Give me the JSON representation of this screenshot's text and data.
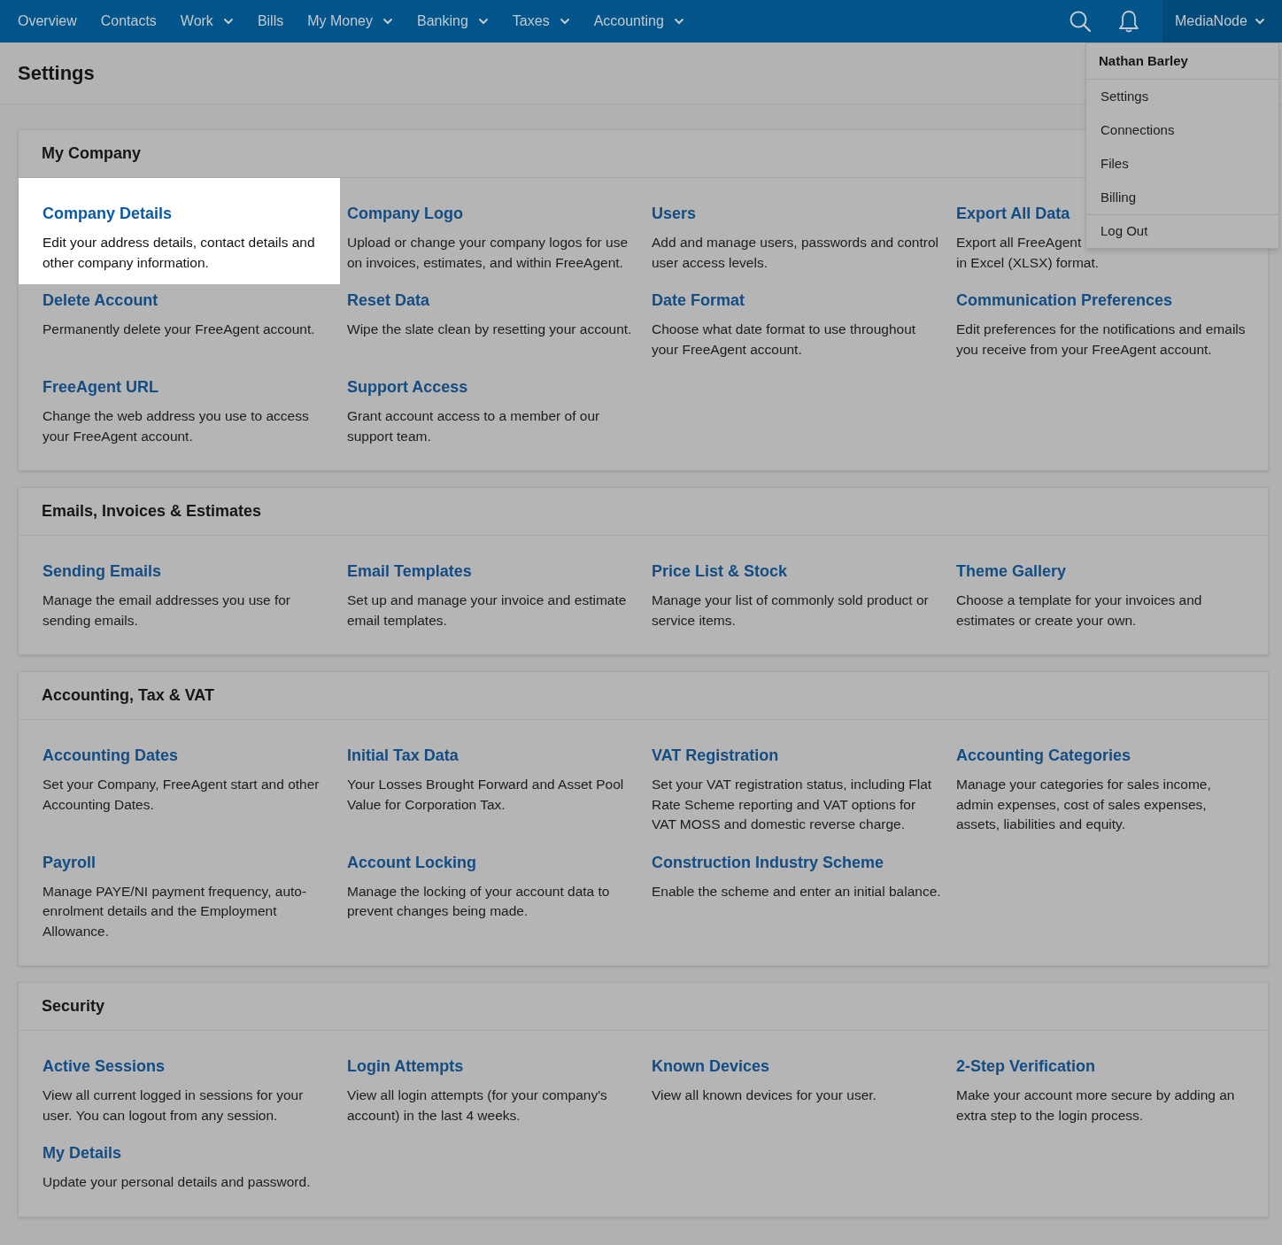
{
  "nav": {
    "items": [
      {
        "label": "Overview",
        "dropdown": false
      },
      {
        "label": "Contacts",
        "dropdown": false
      },
      {
        "label": "Work",
        "dropdown": true
      },
      {
        "label": "Bills",
        "dropdown": false
      },
      {
        "label": "My Money",
        "dropdown": true
      },
      {
        "label": "Banking",
        "dropdown": true
      },
      {
        "label": "Taxes",
        "dropdown": true
      },
      {
        "label": "Accounting",
        "dropdown": true
      }
    ],
    "account": "MediaNode"
  },
  "page_title": "Settings",
  "account_menu": {
    "header": "Nathan Barley",
    "items": [
      {
        "label": "Settings",
        "divider_before": false
      },
      {
        "label": "Connections",
        "divider_before": false
      },
      {
        "label": "Files",
        "divider_before": false
      },
      {
        "label": "Billing",
        "divider_before": false
      },
      {
        "label": "Log Out",
        "divider_before": true
      }
    ]
  },
  "sections": [
    {
      "title": "My Company",
      "items": [
        {
          "title": "Company Details",
          "description": "Edit your address details, contact details and other company information.",
          "highlighted": true
        },
        {
          "title": "Company Logo",
          "description": "Upload or change your company logos for use on invoices, estimates, and within FreeAgent.",
          "highlighted": false
        },
        {
          "title": "Users",
          "description": "Add and manage users, passwords and control user access levels.",
          "highlighted": false
        },
        {
          "title": "Export All Data",
          "description": "Export all FreeAgent\nin Excel (XLSX) format.",
          "highlighted": false
        },
        {
          "title": "Delete Account",
          "description": "Permanently delete your FreeAgent account.",
          "highlighted": false
        },
        {
          "title": "Reset Data",
          "description": "Wipe the slate clean by resetting your account.",
          "highlighted": false
        },
        {
          "title": "Date Format",
          "description": "Choose what date format to use throughout your FreeAgent account.",
          "highlighted": false
        },
        {
          "title": "Communication Preferences",
          "description": "Edit preferences for the notifications and emails you receive from your FreeAgent account.",
          "highlighted": false
        },
        {
          "title": "FreeAgent URL",
          "description": "Change the web address you use to access your FreeAgent account.",
          "highlighted": false
        },
        {
          "title": "Support Access",
          "description": "Grant account access to a member of our support team.",
          "highlighted": false
        }
      ]
    },
    {
      "title": "Emails, Invoices & Estimates",
      "items": [
        {
          "title": "Sending Emails",
          "description": "Manage the email addresses you use for sending emails.",
          "highlighted": false
        },
        {
          "title": "Email Templates",
          "description": "Set up and manage your invoice and estimate email templates.",
          "highlighted": false
        },
        {
          "title": "Price List & Stock",
          "description": "Manage your list of commonly sold product or service items.",
          "highlighted": false
        },
        {
          "title": "Theme Gallery",
          "description": "Choose a template for your invoices and estimates or create your own.",
          "highlighted": false
        }
      ]
    },
    {
      "title": "Accounting, Tax & VAT",
      "items": [
        {
          "title": "Accounting Dates",
          "description": "Set your Company, FreeAgent start and other Accounting Dates.",
          "highlighted": false
        },
        {
          "title": "Initial Tax Data",
          "description": "Your Losses Brought Forward and Asset Pool Value for Corporation Tax.",
          "highlighted": false
        },
        {
          "title": "VAT Registration",
          "description": "Set your VAT registration status, including Flat Rate Scheme reporting and VAT options for VAT MOSS and domestic reverse charge.",
          "highlighted": false
        },
        {
          "title": "Accounting Categories",
          "description": "Manage your categories for sales income, admin expenses, cost of sales expenses, assets, liabilities and equity.",
          "highlighted": false
        },
        {
          "title": "Payroll",
          "description": "Manage PAYE/NI payment frequency, auto-enrolment details and the Employment Allowance.",
          "highlighted": false
        },
        {
          "title": "Account Locking",
          "description": "Manage the locking of your account data to prevent changes being made.",
          "highlighted": false
        },
        {
          "title": "Construction Industry Scheme",
          "description": "Enable the scheme and enter an initial balance.",
          "highlighted": false
        }
      ]
    },
    {
      "title": "Security",
      "items": [
        {
          "title": "Active Sessions",
          "description": "View all current logged in sessions for your user. You can logout from any session.",
          "highlighted": false
        },
        {
          "title": "Login Attempts",
          "description": "View all login attempts (for your company's account) in the last 4 weeks.",
          "highlighted": false
        },
        {
          "title": "Known Devices",
          "description": "View all known devices for your user.",
          "highlighted": false
        },
        {
          "title": "2-Step Verification",
          "description": "Make your account more secure by adding an extra step to the login process.",
          "highlighted": false
        },
        {
          "title": "My Details",
          "description": "Update your personal details and password.",
          "highlighted": false
        }
      ]
    }
  ]
}
